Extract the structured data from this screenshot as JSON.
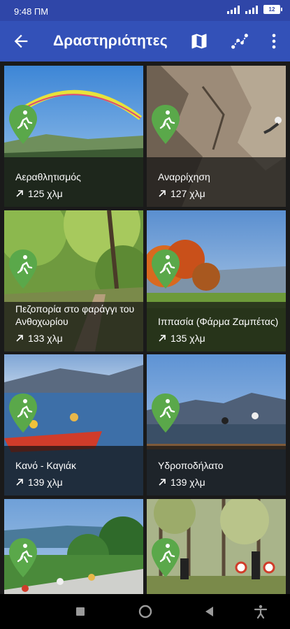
{
  "status": {
    "time": "9:48 ΠΜ",
    "battery": "12"
  },
  "app_bar": {
    "title": "Δραστηριότητες",
    "back_icon": "arrow-left-icon",
    "map_icon": "map-icon",
    "route_icon": "route-icon",
    "menu_icon": "more-vert-icon"
  },
  "activities": [
    {
      "title": "Αεραθλητισμός",
      "distance": "125 χλμ"
    },
    {
      "title": "Αναρρίχηση",
      "distance": "127 χλμ"
    },
    {
      "title": "Πεζοπορία στο φαράγγι του Ανθοχωρίου",
      "distance": "133 χλμ"
    },
    {
      "title": "Ιππασία (Φάρμα Ζαμπέτας)",
      "distance": "135 χλμ"
    },
    {
      "title": "Κανό - Καγιάκ",
      "distance": "139 χλμ"
    },
    {
      "title": "Υδροποδήλατο",
      "distance": "139 χλμ"
    },
    {
      "title": "",
      "distance": ""
    },
    {
      "title": "",
      "distance": ""
    }
  ],
  "colors": {
    "app_bar": "#3351b8",
    "status_bar": "#2f46a8",
    "pin": "#5aa84a"
  }
}
